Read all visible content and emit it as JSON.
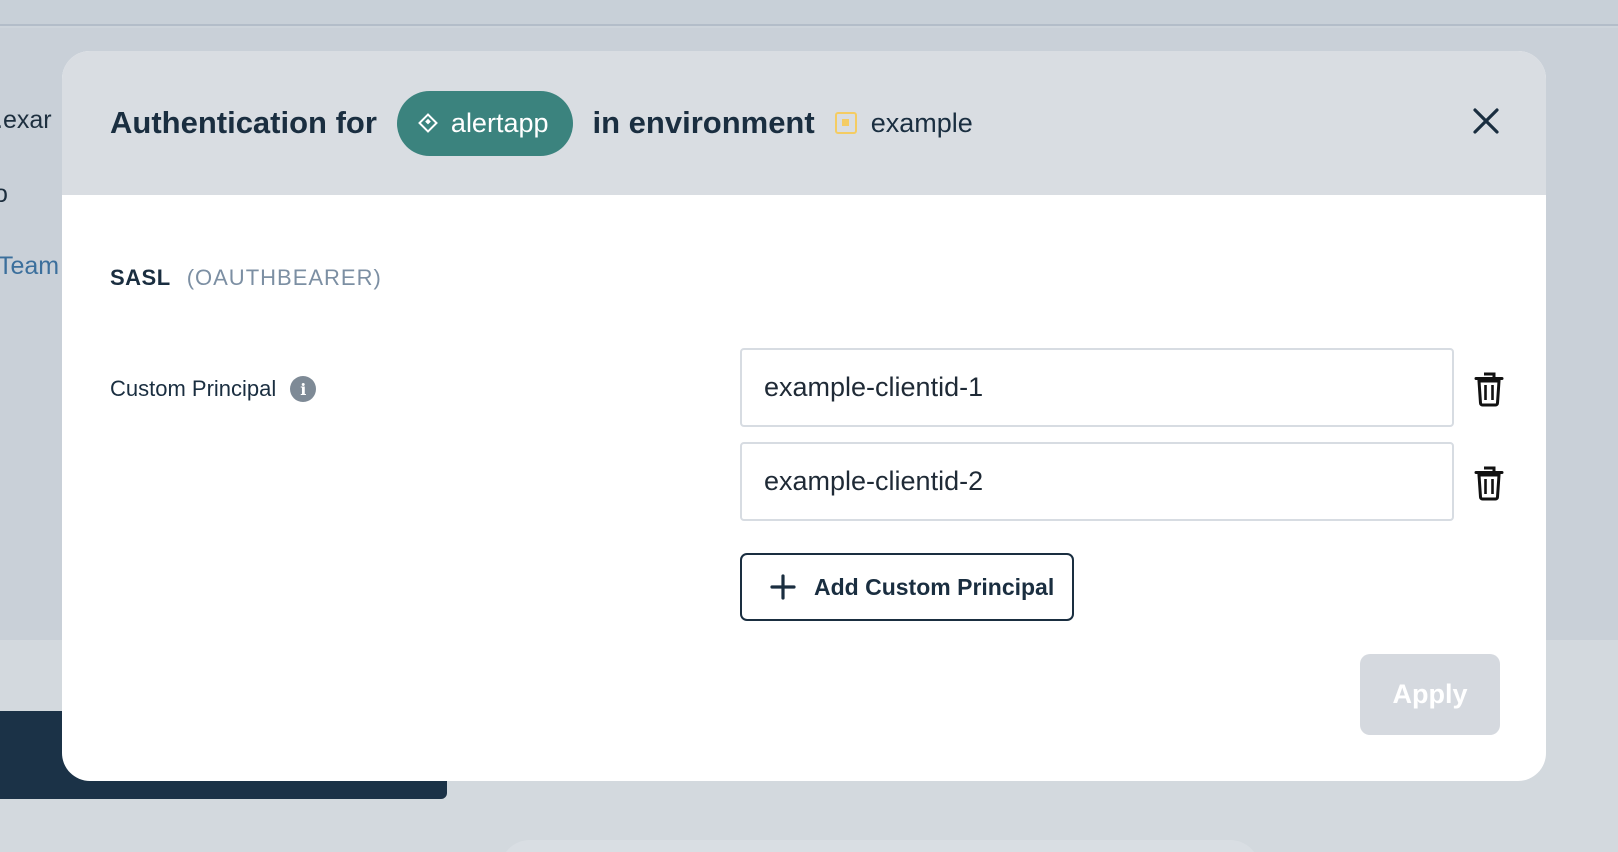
{
  "background": {
    "fragments": [
      ".exar",
      "o",
      "Team"
    ]
  },
  "modal": {
    "title_prefix": "Authentication for",
    "app_name": "alertapp",
    "title_middle": "in environment",
    "environment_name": "example",
    "app_icon": "diamond-icon",
    "environment_icon": "environment-square-icon",
    "close_icon": "close-icon"
  },
  "auth": {
    "sasl_label": "SASL",
    "mechanism": "(OAUTHBEARER)",
    "field_label": "Custom Principal",
    "info_icon": "info-icon",
    "info_glyph": "i",
    "principals": [
      {
        "value": "example-clientid-1"
      },
      {
        "value": "example-clientid-2"
      }
    ],
    "add_label": "Add Custom Principal",
    "apply_label": "Apply"
  },
  "colors": {
    "accent_teal": "#3b837e",
    "env_yellow": "#f4cc63",
    "text_dark": "#1a2e40",
    "apply_disabled": "#d5d9df"
  }
}
